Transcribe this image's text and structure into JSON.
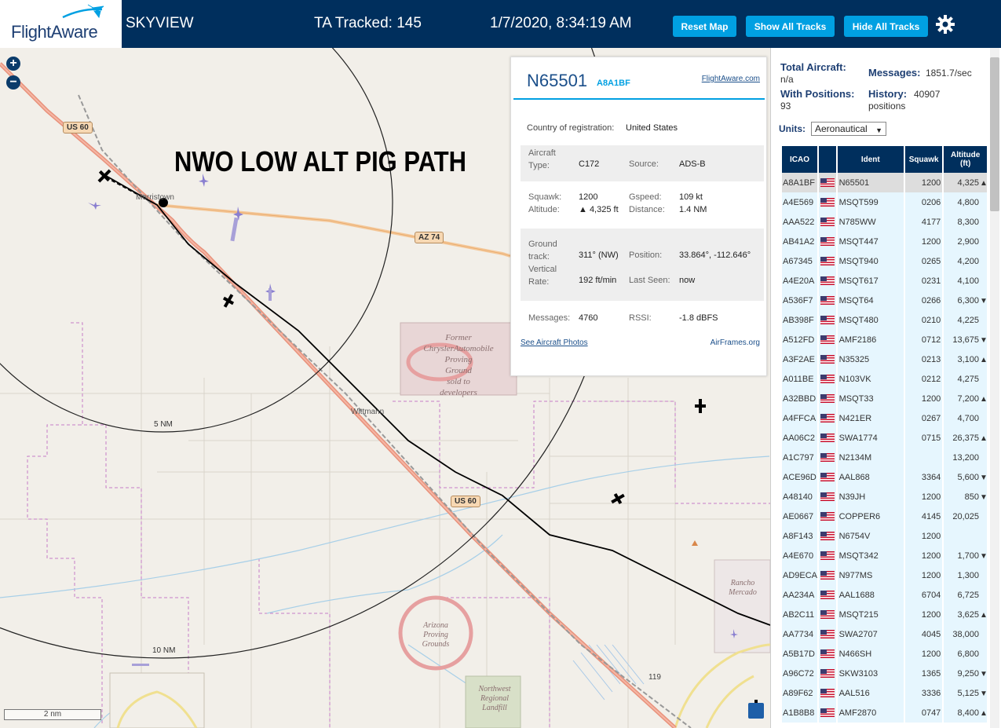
{
  "header": {
    "logo_text": "FlightAware",
    "app_title": "SKYVIEW",
    "tracked_label": "TA Tracked: 145",
    "datetime": "1/7/2020, 8:34:19 AM",
    "buttons": {
      "reset": "Reset Map",
      "show_all": "Show All Tracks",
      "hide_all": "Hide All Tracks"
    },
    "settings_icon": "gear-icon"
  },
  "map": {
    "annotation": "NWO LOW ALT PIG PATH",
    "zoom_in": "+",
    "zoom_out": "−",
    "scale": "2 nm",
    "range_rings": [
      "5 NM",
      "10 NM"
    ],
    "places": {
      "morristown": "Morristown",
      "wittmann": "Wittmann",
      "chrysler": "Former\nChryslerAutomobile\nProving\nGround\nsold to\ndevelopers",
      "arizona_pg": "Arizona\nProving\nGrounds",
      "northwest_landfill": "Northwest\nRegional\nLandfill",
      "rancho": "Rancho\nMercado"
    },
    "shields": {
      "us60_a": "US 60",
      "us60_b": "US 60",
      "az74": "AZ 74",
      "r119": "119"
    },
    "colors": {
      "highway": "#e8927c",
      "road": "#ffffff",
      "track": "#000000",
      "boundary": "#c77dc7",
      "aircraft_other": "#8a7fd0"
    }
  },
  "detail": {
    "ident": "N65501",
    "icao": "A8A1BF",
    "fa_link": "FlightAware.com",
    "country_label": "Country of registration:",
    "country": "United States",
    "aircraft_type_label": "Aircraft\nType:",
    "aircraft_type": "C172",
    "source_label": "Source:",
    "source": "ADS-B",
    "squawk_label": "Squawk:",
    "squawk": "1200",
    "gspeed_label": "Gspeed:",
    "gspeed": "109 kt",
    "altitude_label": "Altitude:",
    "altitude": "▲ 4,325 ft",
    "distance_label": "Distance:",
    "distance": "1.4 NM",
    "ground_track_label": "Ground\ntrack:",
    "ground_track": "311° (NW)",
    "position_label": "Position:",
    "position": "33.864°, -112.646°",
    "vrate_label": "Vertical\nRate:",
    "vrate": "192 ft/min",
    "last_seen_label": "Last Seen:",
    "last_seen": "now",
    "messages_label": "Messages:",
    "messages": "4760",
    "rssi_label": "RSSI:",
    "rssi": "-1.8 dBFS",
    "photos_link": "See Aircraft Photos",
    "airframes_link": "AirFrames.org"
  },
  "sidebar": {
    "total_aircraft_label": "Total Aircraft:",
    "total_aircraft": "n/a",
    "messages_label": "Messages:",
    "messages": "1851.7/sec",
    "with_positions_label": "With Positions:",
    "with_positions": "93",
    "history_label": "History:",
    "history": "40907",
    "history_unit": "positions",
    "units_label": "Units:",
    "units_value": "Aeronautical",
    "columns": [
      "ICAO",
      "",
      "Ident",
      "Squawk",
      "Altitude\n(ft)"
    ],
    "rows": [
      {
        "icao": "A8A1BF",
        "ident": "N65501",
        "squawk": "1200",
        "alt": "4,325",
        "trend": "▲"
      },
      {
        "icao": "A4E569",
        "ident": "MSQT599",
        "squawk": "0206",
        "alt": "4,800",
        "trend": ""
      },
      {
        "icao": "AAA522",
        "ident": "N785WW",
        "squawk": "4177",
        "alt": "8,300",
        "trend": ""
      },
      {
        "icao": "AB41A2",
        "ident": "MSQT447",
        "squawk": "1200",
        "alt": "2,900",
        "trend": ""
      },
      {
        "icao": "A67345",
        "ident": "MSQT940",
        "squawk": "0265",
        "alt": "4,200",
        "trend": ""
      },
      {
        "icao": "A4E20A",
        "ident": "MSQT617",
        "squawk": "0231",
        "alt": "4,100",
        "trend": ""
      },
      {
        "icao": "A536F7",
        "ident": "MSQT64",
        "squawk": "0266",
        "alt": "6,300",
        "trend": "▼"
      },
      {
        "icao": "AB398F",
        "ident": "MSQT480",
        "squawk": "0210",
        "alt": "4,225",
        "trend": ""
      },
      {
        "icao": "A512FD",
        "ident": "AMF2186",
        "squawk": "0712",
        "alt": "13,675",
        "trend": "▼"
      },
      {
        "icao": "A3F2AE",
        "ident": "N35325",
        "squawk": "0213",
        "alt": "3,100",
        "trend": "▲"
      },
      {
        "icao": "A011BE",
        "ident": "N103VK",
        "squawk": "0212",
        "alt": "4,275",
        "trend": ""
      },
      {
        "icao": "A32BBD",
        "ident": "MSQT33",
        "squawk": "1200",
        "alt": "7,200",
        "trend": "▲"
      },
      {
        "icao": "A4FFCA",
        "ident": "N421ER",
        "squawk": "0267",
        "alt": "4,700",
        "trend": ""
      },
      {
        "icao": "AA06C2",
        "ident": "SWA1774",
        "squawk": "0715",
        "alt": "26,375",
        "trend": "▲"
      },
      {
        "icao": "A1C797",
        "ident": "N2134M",
        "squawk": "",
        "alt": "13,200",
        "trend": ""
      },
      {
        "icao": "ACE96D",
        "ident": "AAL868",
        "squawk": "3364",
        "alt": "5,600",
        "trend": "▼"
      },
      {
        "icao": "A48140",
        "ident": "N39JH",
        "squawk": "1200",
        "alt": "850",
        "trend": "▼"
      },
      {
        "icao": "AE0667",
        "ident": "COPPER6",
        "squawk": "4145",
        "alt": "20,025",
        "trend": ""
      },
      {
        "icao": "A8F143",
        "ident": "N6754V",
        "squawk": "1200",
        "alt": "",
        "trend": ""
      },
      {
        "icao": "A4E670",
        "ident": "MSQT342",
        "squawk": "1200",
        "alt": "1,700",
        "trend": "▼"
      },
      {
        "icao": "AD9ECA",
        "ident": "N977MS",
        "squawk": "1200",
        "alt": "1,300",
        "trend": ""
      },
      {
        "icao": "AA234A",
        "ident": "AAL1688",
        "squawk": "6704",
        "alt": "6,725",
        "trend": ""
      },
      {
        "icao": "AB2C11",
        "ident": "MSQT215",
        "squawk": "1200",
        "alt": "3,625",
        "trend": "▲"
      },
      {
        "icao": "AA7734",
        "ident": "SWA2707",
        "squawk": "4045",
        "alt": "38,000",
        "trend": ""
      },
      {
        "icao": "A5B17D",
        "ident": "N466SH",
        "squawk": "1200",
        "alt": "6,800",
        "trend": ""
      },
      {
        "icao": "A96C72",
        "ident": "SKW3103",
        "squawk": "1365",
        "alt": "9,250",
        "trend": "▼"
      },
      {
        "icao": "A89F62",
        "ident": "AAL516",
        "squawk": "3336",
        "alt": "5,125",
        "trend": "▼"
      },
      {
        "icao": "A1B8B8",
        "ident": "AMF2870",
        "squawk": "0747",
        "alt": "8,400",
        "trend": "▲"
      }
    ]
  }
}
